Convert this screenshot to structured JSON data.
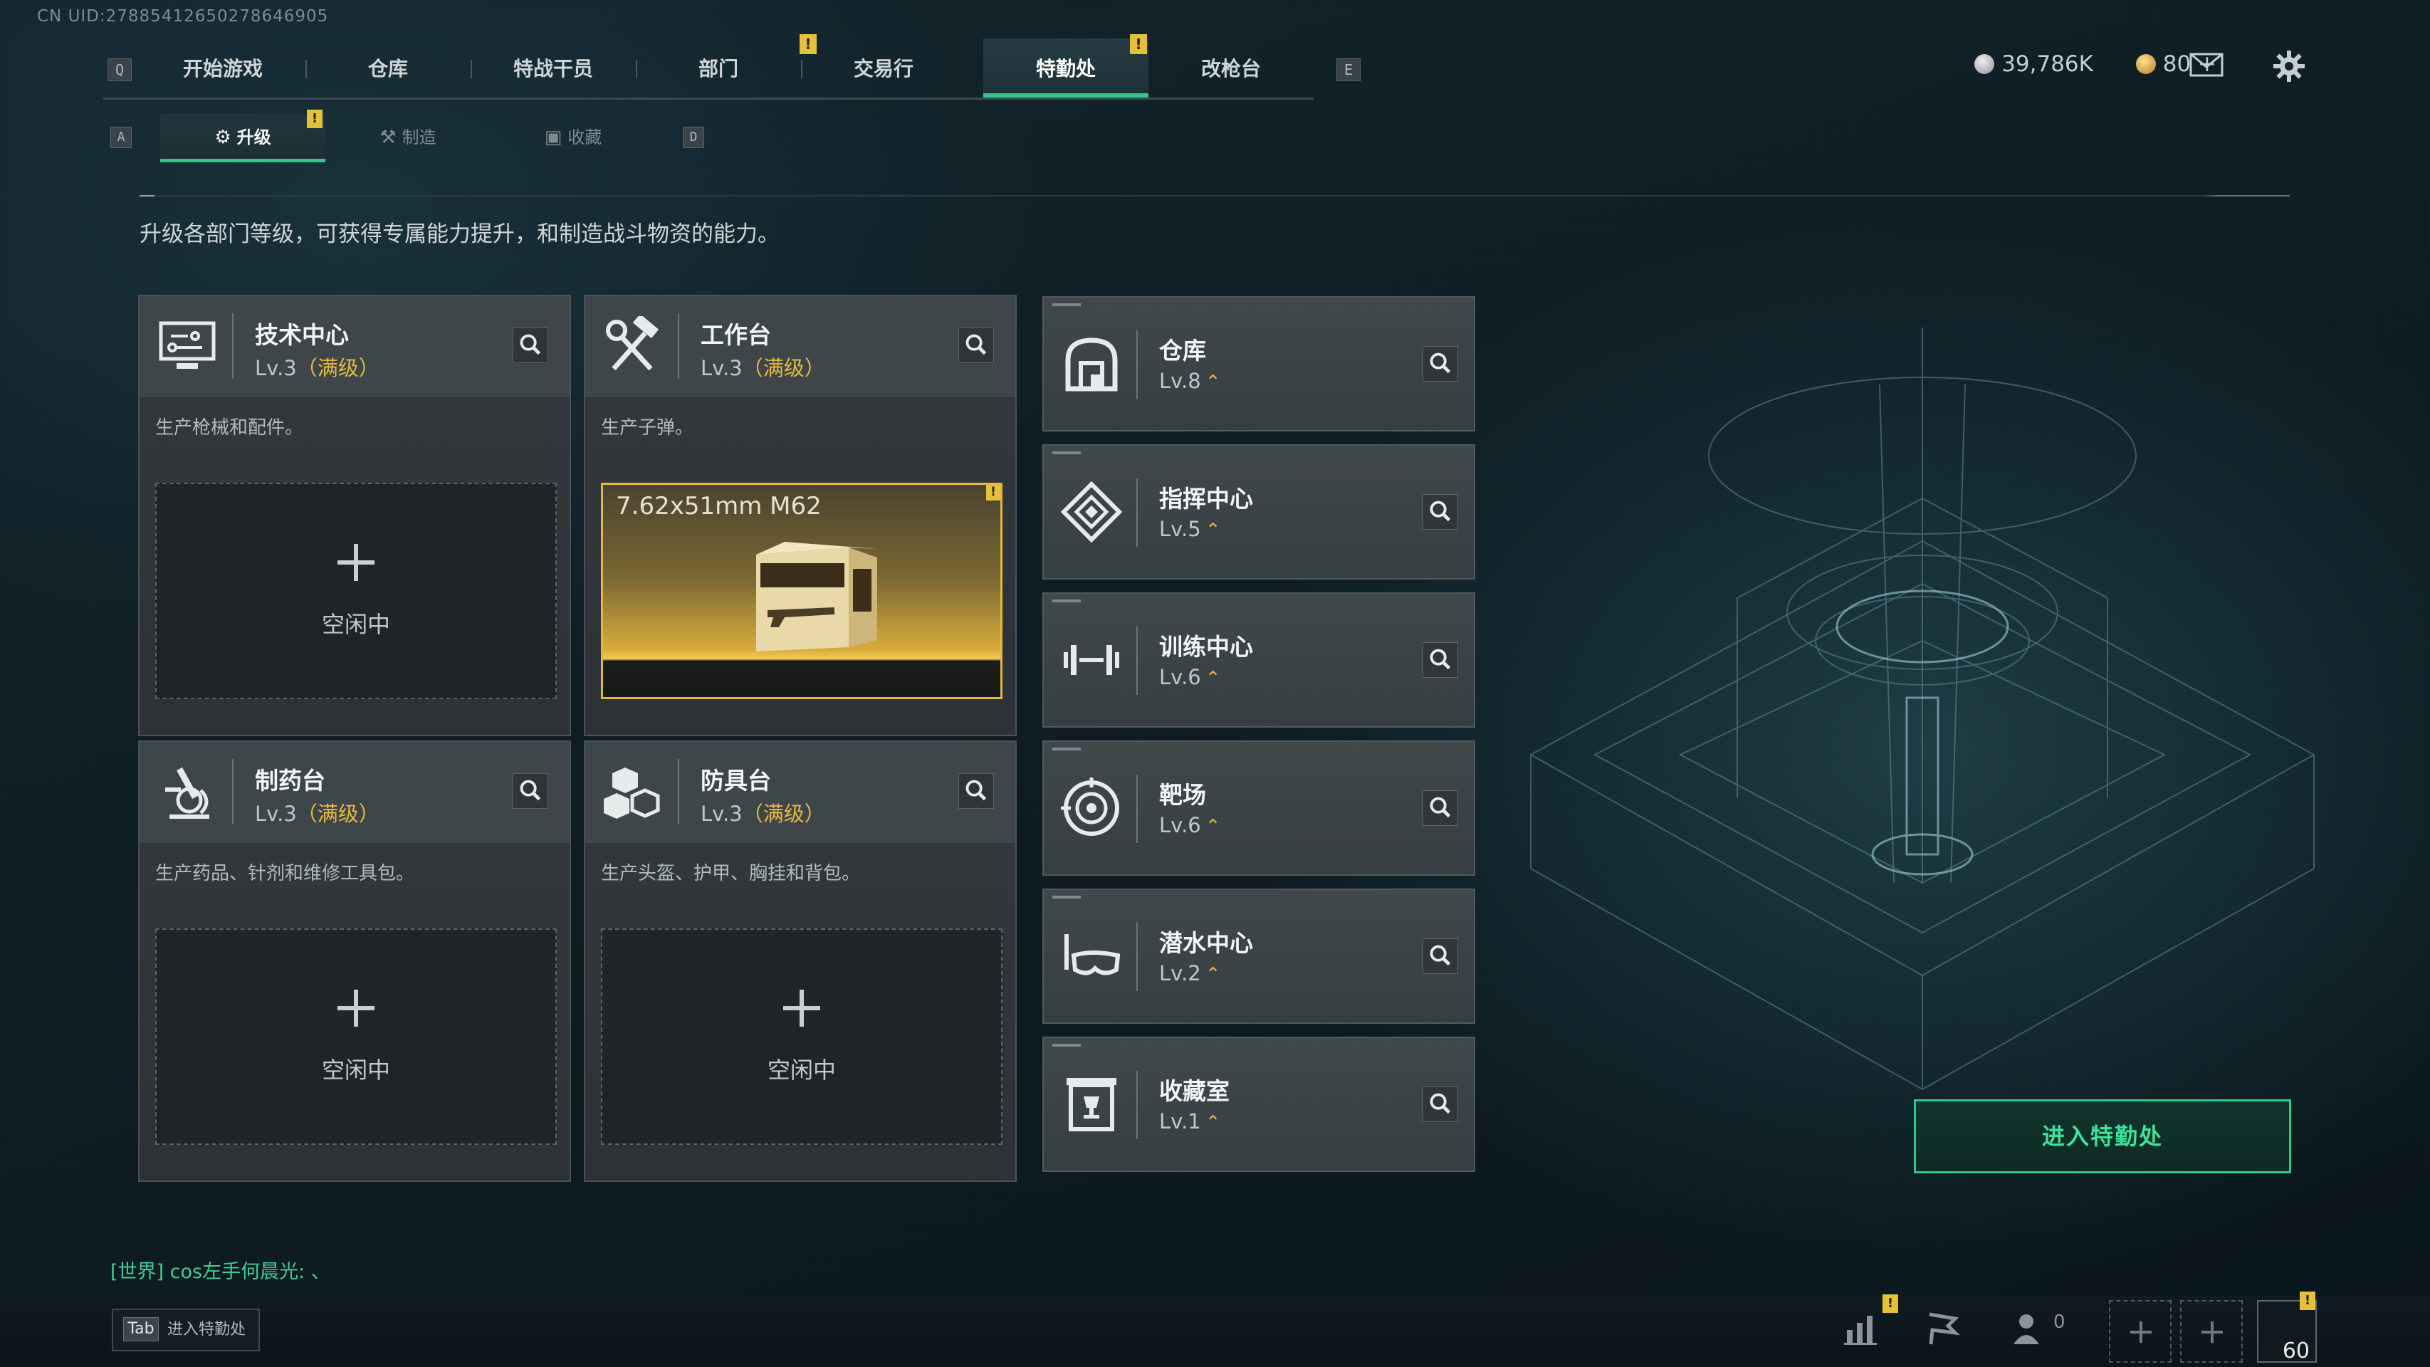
{
  "uid": "CN UID:2788541265027864690​5",
  "nav": {
    "key_left": "Q",
    "key_right": "E",
    "tabs": [
      "开始游戏",
      "仓库",
      "特战干员",
      "部门",
      "交易行",
      "特勤处",
      "改枪台"
    ],
    "active_index": 5
  },
  "alert_mark": "!",
  "subnav": {
    "key_left": "A",
    "key_right": "D",
    "tabs": [
      "升级",
      "制造",
      "收藏"
    ],
    "active_index": 0
  },
  "currency": {
    "silver": "39,786K",
    "gold": "80 +"
  },
  "description": "升级各部门等级，可获得专属能力提升，和制造战斗物资的能力。",
  "big_cards": [
    {
      "name": "技术中心",
      "level": "Lv.3",
      "max_label": "（满级）",
      "desc": "生产枪械和配件。",
      "icon": "computer-icon",
      "slot": "空闲中"
    },
    {
      "name": "工作台",
      "level": "Lv.3",
      "max_label": "（满级）",
      "desc": "生产子弹。",
      "icon": "hammer-wrench-icon",
      "crafting": "7.62x51mm M62"
    },
    {
      "name": "制药台",
      "level": "Lv.3",
      "max_label": "（满级）",
      "desc": "生产药品、针剂和维修工具包。",
      "icon": "microscope-icon",
      "slot": "空闲中"
    },
    {
      "name": "防具台",
      "level": "Lv.3",
      "max_label": "（满级）",
      "desc": "生产头盔、护甲、胸挂和背包。",
      "icon": "cubes-icon",
      "slot": "空闲中"
    }
  ],
  "small_cards": [
    {
      "name": "仓库",
      "level": "Lv.8",
      "icon": "warehouse-icon"
    },
    {
      "name": "指挥中心",
      "level": "Lv.5",
      "icon": "command-icon"
    },
    {
      "name": "训练中心",
      "level": "Lv.6",
      "icon": "dumbbell-icon"
    },
    {
      "name": "靶场",
      "level": "Lv.6",
      "icon": "target-icon"
    },
    {
      "name": "潜水中心",
      "level": "Lv.2",
      "icon": "diving-mask-icon"
    },
    {
      "name": "收藏室",
      "level": "Lv.1",
      "icon": "trophy-case-icon"
    }
  ],
  "upgrade_mark": "⌃",
  "enter_button": "进入特勤处",
  "chat": "[世界] cos左手何晨光: 、",
  "bottom": {
    "tab_key": "Tab",
    "tab_label": "进入特勤处",
    "friends_count": "0",
    "level": "60"
  },
  "colors": {
    "accent": "#2fc78a",
    "gold": "#e4b83e"
  }
}
